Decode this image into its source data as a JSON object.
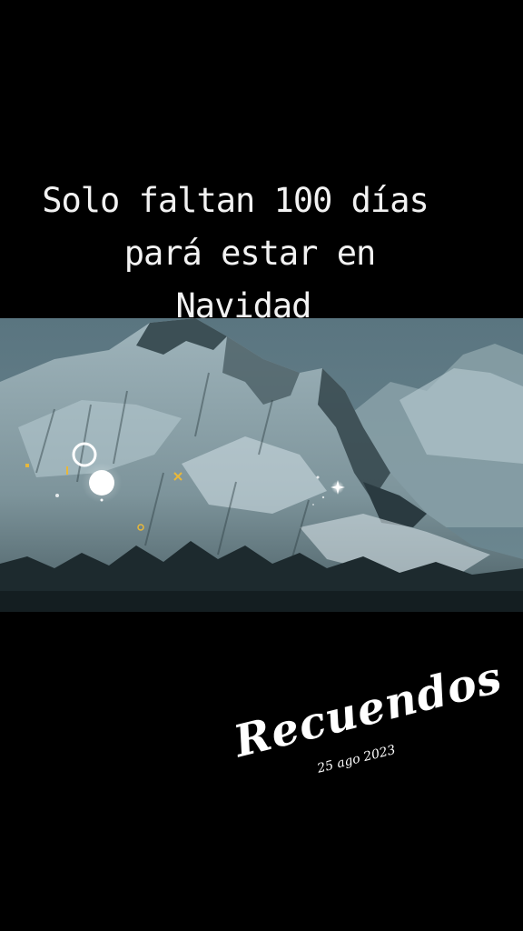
{
  "caption": {
    "line1": "Solo faltan 100 días",
    "line2": "pará estar en",
    "line3": "Navidad"
  },
  "stamp": {
    "title": "Recuendos",
    "date": "25 ago 2023"
  },
  "photo": {
    "subject": "snowy-mountain",
    "sky_color": "#4e6a74",
    "snow_color": "#b4c8cf",
    "rock_color": "#2a3a40"
  },
  "colors": {
    "background": "#000000",
    "text": "#f2f2f2",
    "sparkle_accent": "#e8b83a"
  }
}
